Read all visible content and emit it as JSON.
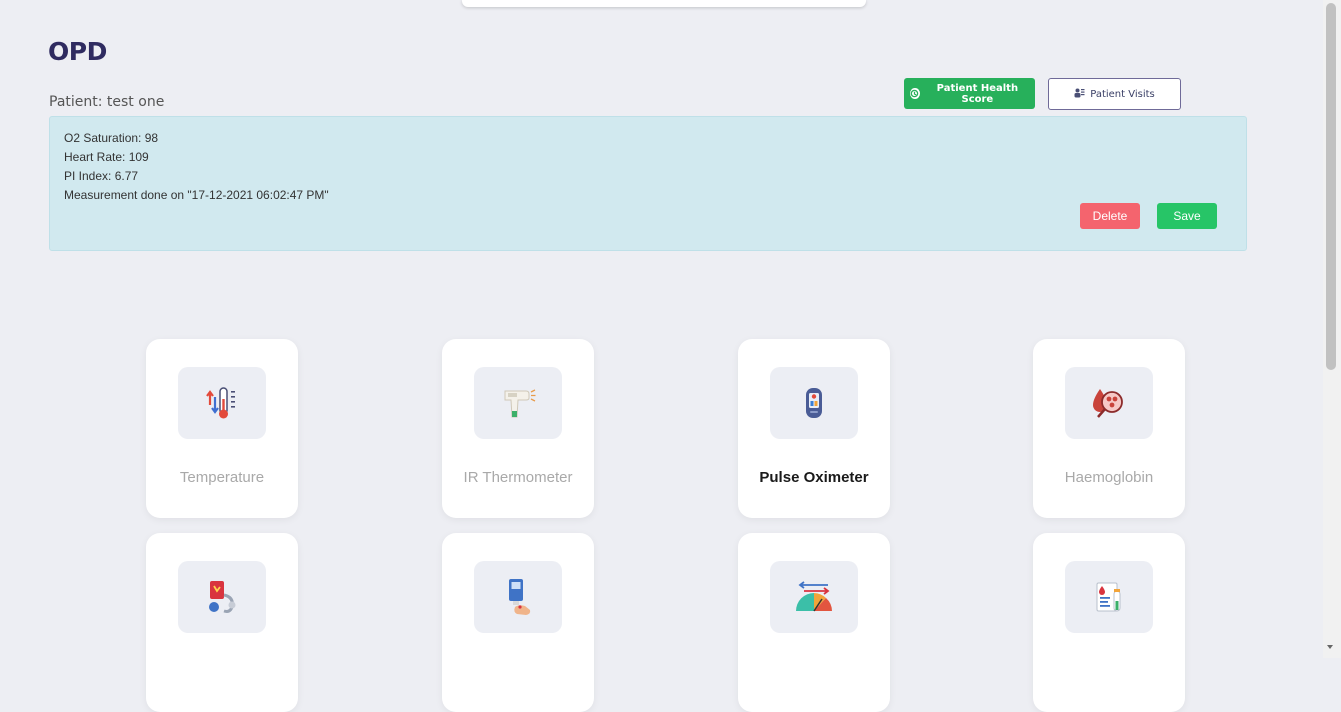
{
  "header": {
    "title": "OPD",
    "patient_line": "Patient: test one"
  },
  "actions": {
    "health_score_label": "Patient Health Score",
    "visits_label": "Patient Visits"
  },
  "measurement": {
    "lines": [
      "O2 Saturation: 98",
      "Heart Rate: 109",
      "PI Index: 6.77",
      "Measurement done on \"17-12-2021 06:02:47 PM\""
    ],
    "delete_label": "Delete",
    "save_label": "Save"
  },
  "devices": [
    {
      "label": "Temperature",
      "icon": "temperature-icon",
      "active": false
    },
    {
      "label": "IR Thermometer",
      "icon": "ir-thermometer-icon",
      "active": false
    },
    {
      "label": "Pulse Oximeter",
      "icon": "pulse-oximeter-icon",
      "active": true
    },
    {
      "label": "Haemoglobin",
      "icon": "haemoglobin-icon",
      "active": false
    },
    {
      "label": "",
      "icon": "blood-pressure-icon",
      "active": false
    },
    {
      "label": "",
      "icon": "glucometer-icon",
      "active": false
    },
    {
      "label": "",
      "icon": "gauge-meter-icon",
      "active": false
    },
    {
      "label": "",
      "icon": "lab-report-icon",
      "active": false
    }
  ],
  "colors": {
    "accent_green": "#27b05b",
    "delete_red": "#f4646e",
    "panel_bg": "#d1e9ef",
    "title_color": "#2f2b60"
  }
}
